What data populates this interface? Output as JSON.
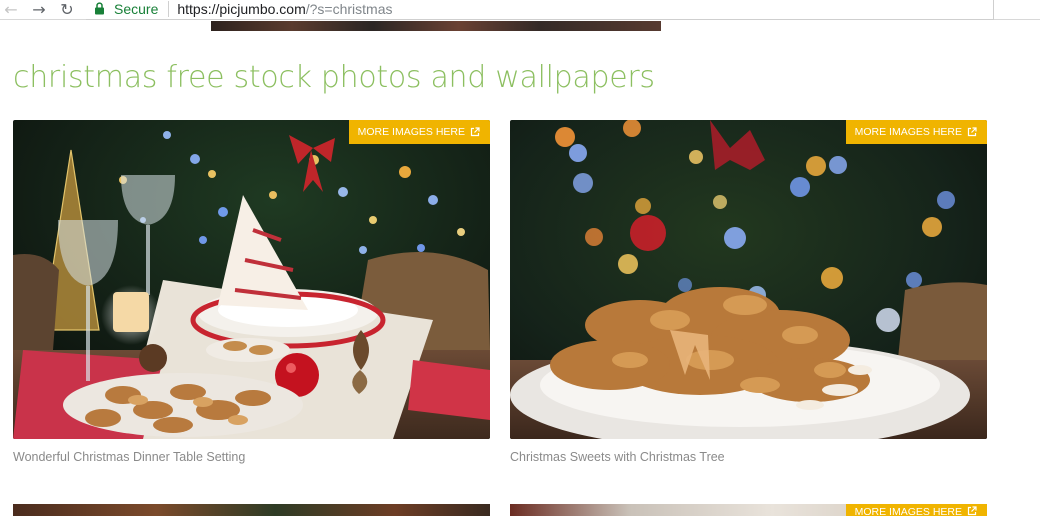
{
  "browser": {
    "secure_label": "Secure",
    "url_host": "https://picjumbo.com",
    "url_path": "/?s=christmas"
  },
  "page": {
    "title": "christmas free stock photos and wallpapers"
  },
  "cards": [
    {
      "more_label": "MORE IMAGES HERE",
      "caption": "Wonderful Christmas Dinner Table Setting"
    },
    {
      "more_label": "MORE IMAGES HERE",
      "caption": "Christmas Sweets with Christmas Tree"
    }
  ],
  "second_row": {
    "more_label": "MORE IMAGES HERE"
  },
  "colors": {
    "title_green": "#8cbf60",
    "button_yellow": "#f0b400",
    "caption_gray": "#8a8a8a",
    "secure_green": "#188038"
  },
  "icons": [
    "back-arrow-icon",
    "forward-arrow-icon",
    "reload-icon",
    "lock-icon",
    "external-link-icon"
  ]
}
